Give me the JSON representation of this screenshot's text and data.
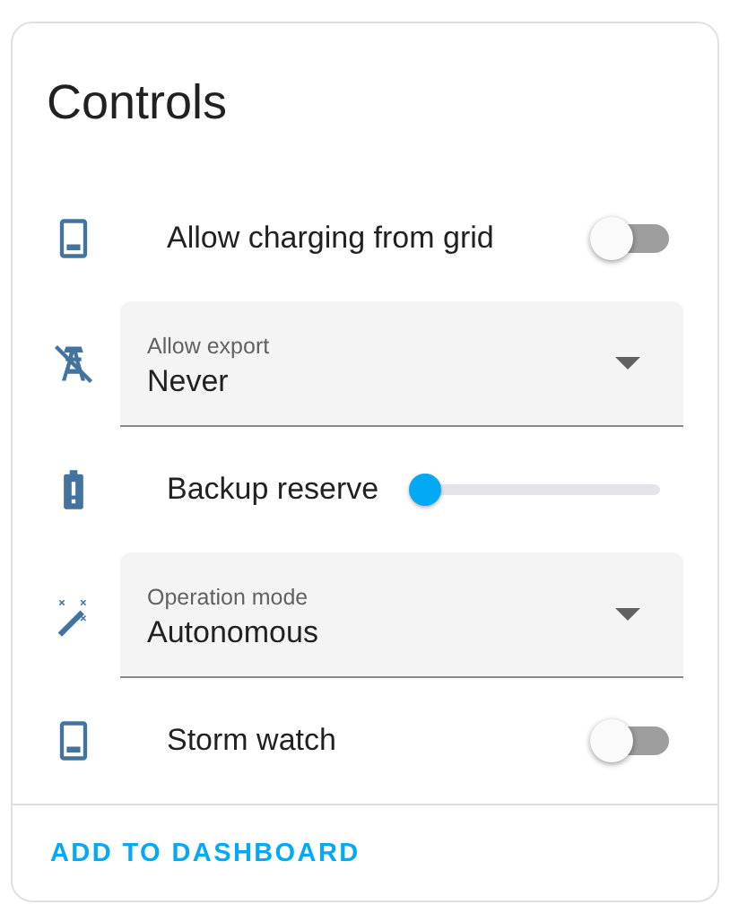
{
  "card": {
    "title": "Controls",
    "controls": [
      {
        "kind": "toggle",
        "label": "Allow charging from grid",
        "on": false
      },
      {
        "kind": "select",
        "label": "Allow export",
        "value": "Never"
      },
      {
        "kind": "slider",
        "label": "Backup reserve",
        "level": 0
      },
      {
        "kind": "select",
        "label": "Operation mode",
        "value": "Autonomous"
      },
      {
        "kind": "toggle",
        "label": "Storm watch",
        "on": false
      }
    ],
    "action": "ADD TO DASHBOARD"
  }
}
